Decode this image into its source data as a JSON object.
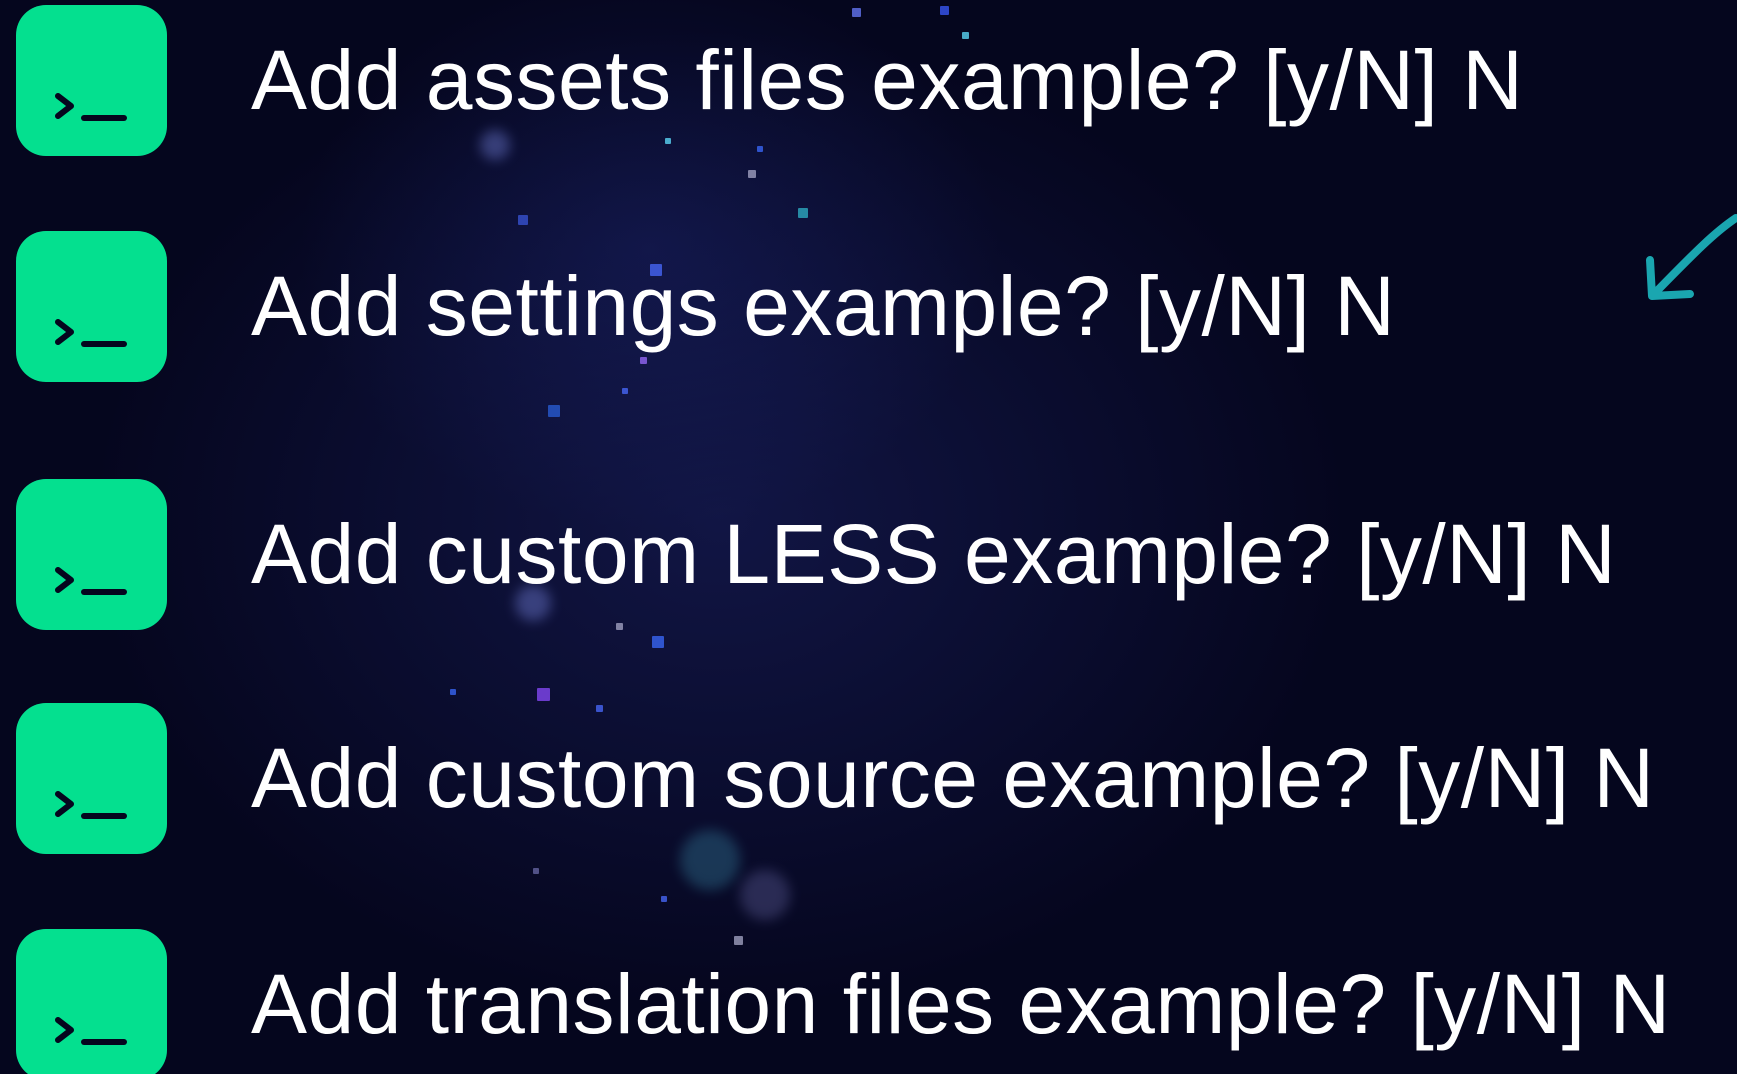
{
  "colors": {
    "background": "#05061e",
    "tile": "#04e08f",
    "text": "#ffffff",
    "arrow": "#1aa6b0"
  },
  "prompts": [
    {
      "icon": "terminal-icon",
      "text": "Add assets files example? [y/N] N"
    },
    {
      "icon": "terminal-icon",
      "text": "Add settings example? [y/N] N"
    },
    {
      "icon": "terminal-icon",
      "text": "Add custom LESS example? [y/N] N"
    },
    {
      "icon": "terminal-icon",
      "text": "Add custom source example? [y/N] N"
    },
    {
      "icon": "terminal-icon",
      "text": "Add translation files example? [y/N] N"
    }
  ],
  "annotation": {
    "icon": "curved-arrow-icon"
  }
}
